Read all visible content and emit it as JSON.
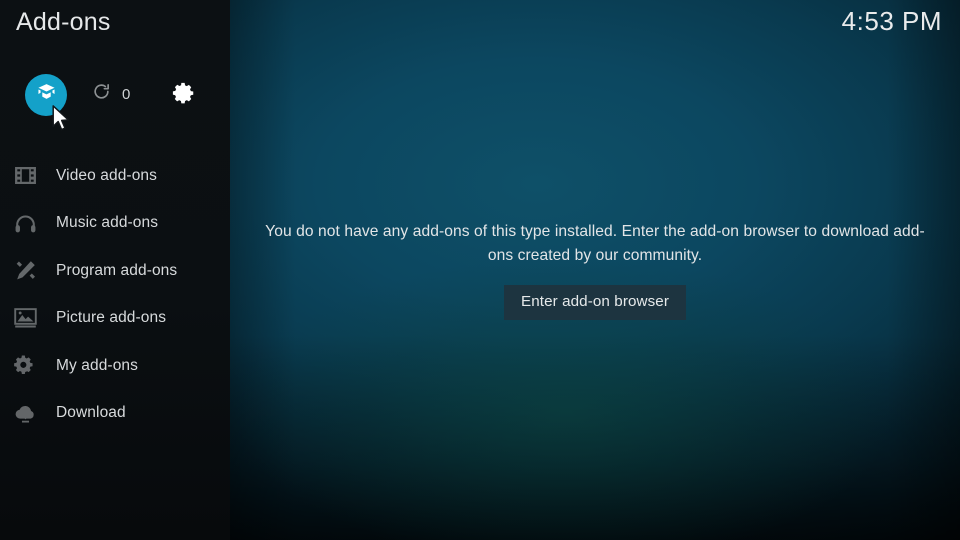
{
  "window": {
    "title": "Add-ons",
    "clock": "4:53 PM"
  },
  "toolbar": {
    "addon_button_icon": "package-box-icon",
    "refresh_icon": "refresh-icon",
    "refresh_count": "0",
    "settings_icon": "gear-icon"
  },
  "sidebar": {
    "items": [
      {
        "label": "Video add-ons",
        "icon": "film-strip-icon"
      },
      {
        "label": "Music add-ons",
        "icon": "headphones-icon"
      },
      {
        "label": "Program add-ons",
        "icon": "pencil-tools-icon"
      },
      {
        "label": "Picture add-ons",
        "icon": "picture-icon"
      },
      {
        "label": "My add-ons",
        "icon": "gear-wrench-icon"
      },
      {
        "label": "Download",
        "icon": "cloud-download-icon"
      }
    ]
  },
  "main": {
    "empty_message": "You do not have any add-ons of this type installed. Enter the add-on browser to download add-ons created by our community.",
    "browser_button_label": "Enter add-on browser"
  },
  "colors": {
    "accent": "#14a1c9",
    "sidebar_bg": "#0c1013",
    "content_center": "#0e5068",
    "button_bg": "#1d3440",
    "text_primary": "#e6e8e9"
  }
}
